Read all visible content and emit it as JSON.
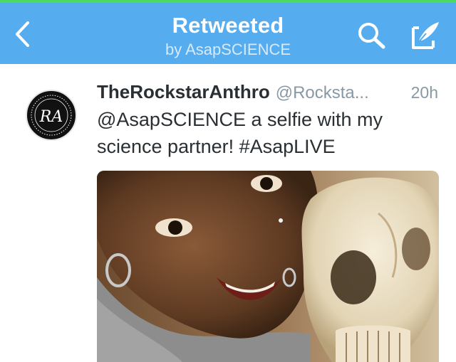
{
  "status_bar": {
    "accent_color": "#4cd964"
  },
  "navbar": {
    "title": "Retweeted",
    "subtitle": "by AsapSCIENCE",
    "background_color": "#55acee",
    "back_icon": "chevron-left-icon",
    "search_icon": "search-icon",
    "compose_icon": "compose-icon"
  },
  "tweet": {
    "display_name": "TheRockstarAnthro",
    "handle": "@Rocksta...",
    "timestamp": "20h",
    "text_line1": "@AsapSCIENCE a selfie with my",
    "text_line2": "science partner! #AsapLIVE",
    "avatar_monogram": "RA",
    "media": {
      "type": "photo",
      "subject": "selfie with a skull"
    }
  }
}
